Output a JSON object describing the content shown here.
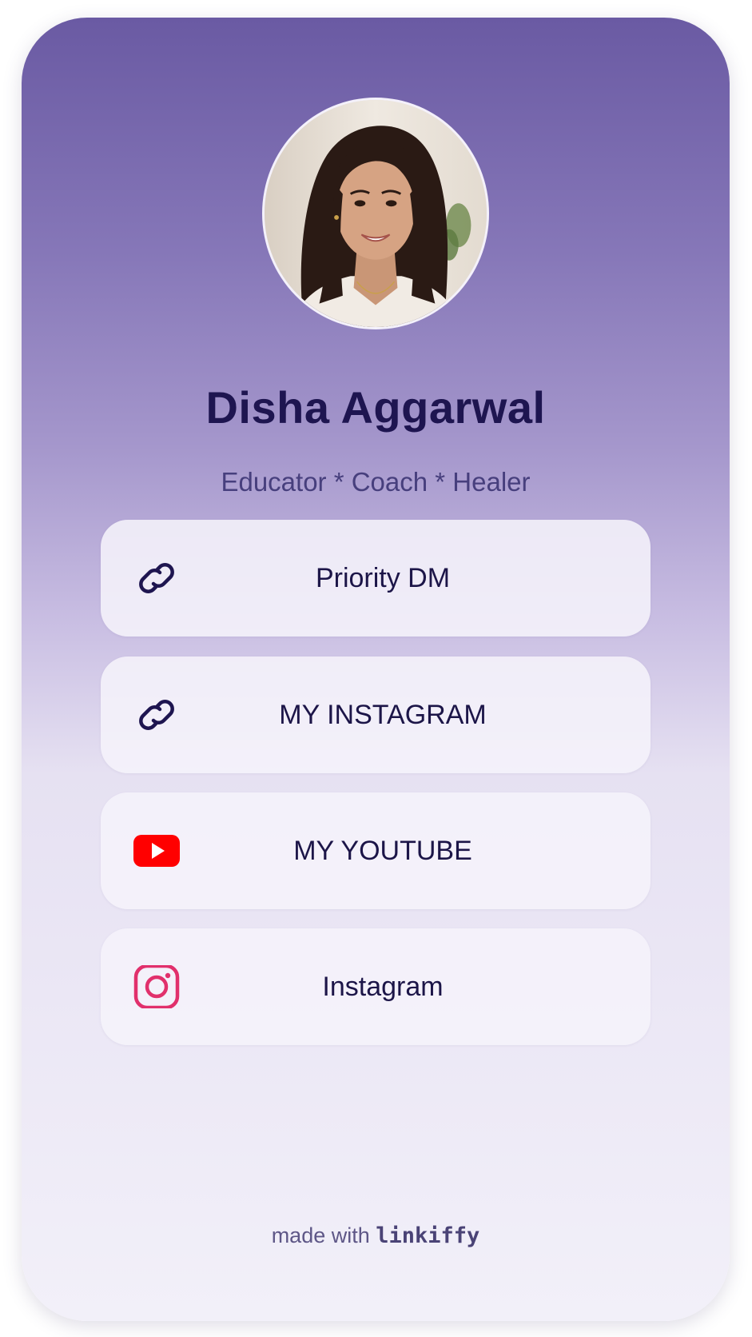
{
  "profile": {
    "name": "Disha Aggarwal",
    "tagline": "Educator * Coach * Healer",
    "avatar_icon": "profile-photo"
  },
  "links": [
    {
      "label": "Priority DM",
      "icon": "link-icon"
    },
    {
      "label": "MY INSTAGRAM",
      "icon": "link-icon"
    },
    {
      "label": "MY YOUTUBE",
      "icon": "youtube-icon"
    },
    {
      "label": "Instagram",
      "icon": "instagram-icon"
    }
  ],
  "footer": {
    "prefix": "made with",
    "brand": "linkiffy"
  },
  "colors": {
    "accent_dark": "#1e1550",
    "tagline": "#473f7d",
    "youtube_red": "#ff0000",
    "instagram_pink": "#e1306c",
    "gradient_top": "#6a5aa3",
    "gradient_bottom": "#f2f0f9"
  }
}
